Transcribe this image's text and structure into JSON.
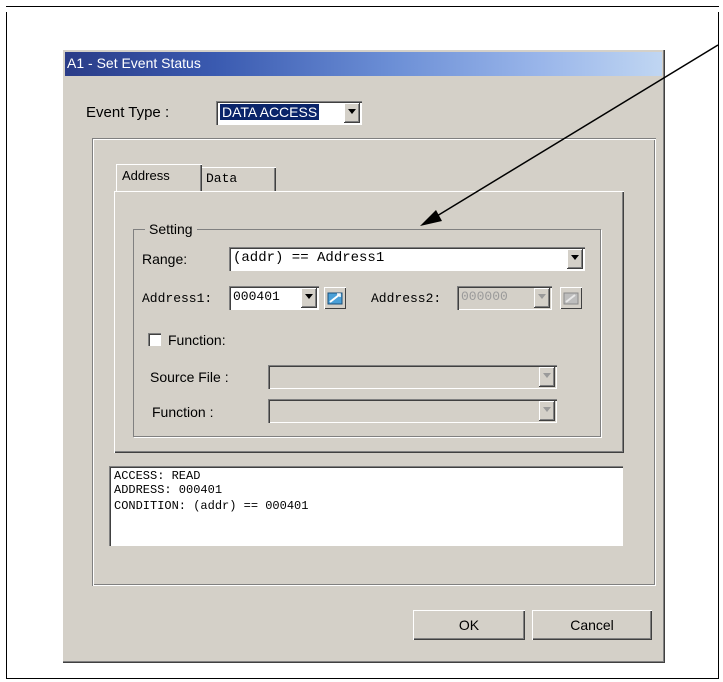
{
  "dialog": {
    "title": "A1 - Set Event Status",
    "event_type_label": "Event Type :",
    "event_type_value": "DATA ACCESS",
    "tabs": [
      {
        "label": "Address",
        "active": true
      },
      {
        "label": "Data",
        "active": false
      }
    ],
    "setting": {
      "group_label": "Setting",
      "range_label": "Range:",
      "range_value": "(addr) == Address1",
      "address1_label": "Address1:",
      "address1_value": "000401",
      "address2_label": "Address2:",
      "address2_value": "000000",
      "function_checkbox_label": "Function:",
      "function_checked": false,
      "source_file_label": "Source File :",
      "source_file_value": "",
      "function_label": "Function :",
      "function_value": ""
    },
    "info": {
      "lines": [
        "ACCESS: READ",
        "ADDRESS: 000401",
        "CONDITION: (addr) == 000401"
      ]
    },
    "buttons": {
      "ok": "OK",
      "cancel": "Cancel"
    }
  },
  "icons": {
    "dropdown": "chevron-down-icon",
    "symbol_browse": "symbol-browse-icon",
    "annotation_arrow": "annotation-arrow"
  },
  "colors": {
    "dialog_bg": "#d4d0c8",
    "titlebar_start": "#2a3c88",
    "titlebar_end": "#c0d6f2",
    "selection": "#0a246a"
  }
}
